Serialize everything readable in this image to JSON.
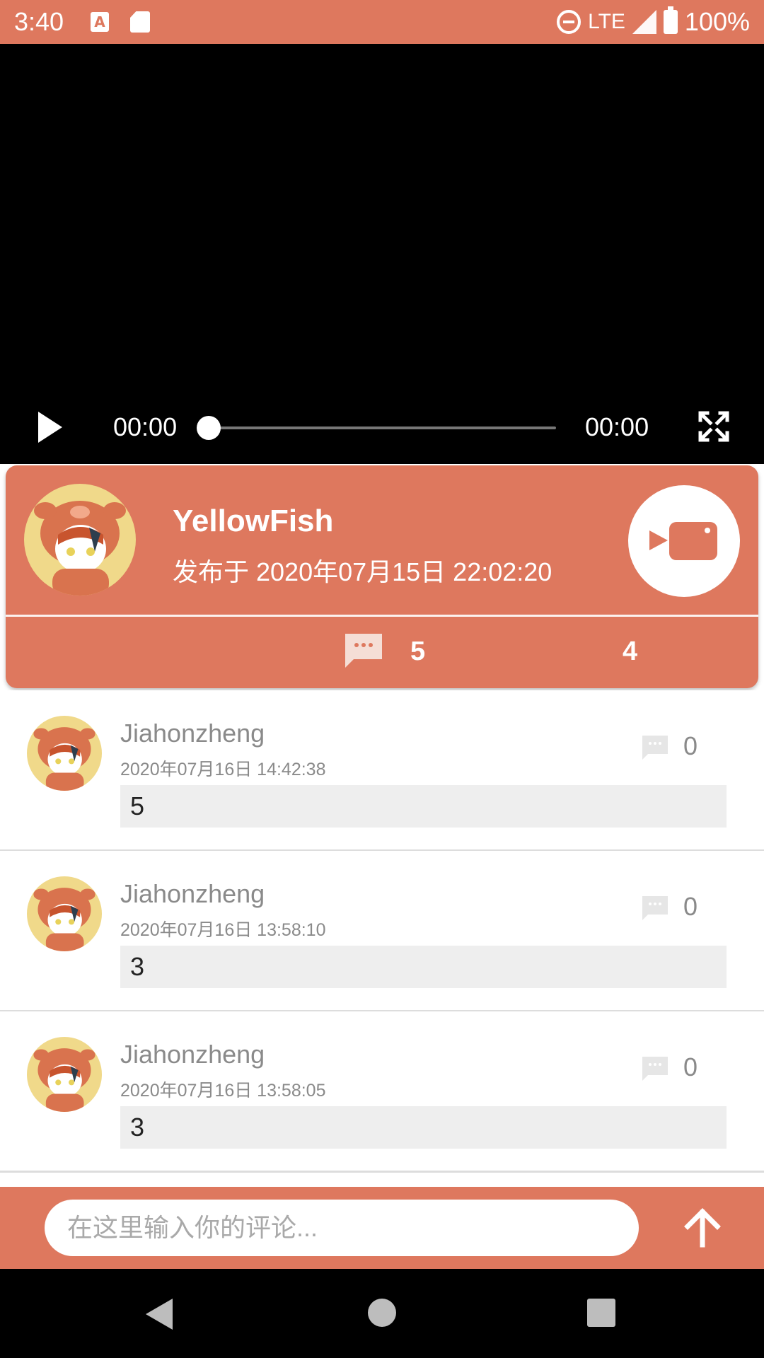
{
  "status_bar": {
    "time": "3:40",
    "network": "LTE",
    "battery": "100%"
  },
  "video": {
    "current_time": "00:00",
    "total_time": "00:00",
    "progress": 0
  },
  "post": {
    "author": "YellowFish",
    "published": "发布于 2020年07月15日 22:02:20",
    "comment_count": "5",
    "other_count": "4"
  },
  "comments": [
    {
      "name": "Jiahonzheng",
      "date": "2020年07月16日 14:42:38",
      "reply_count": "0",
      "body": "5"
    },
    {
      "name": "Jiahonzheng",
      "date": "2020年07月16日 13:58:10",
      "reply_count": "0",
      "body": "3"
    },
    {
      "name": "Jiahonzheng",
      "date": "2020年07月16日 13:58:05",
      "reply_count": "0",
      "body": "3"
    }
  ],
  "input": {
    "placeholder": "在这里输入你的评论..."
  },
  "icons": {
    "play": "play-icon",
    "fullscreen": "fullscreen-icon",
    "video_badge": "video-camera-icon",
    "comment": "comment-bubble-icon",
    "send": "arrow-up-icon",
    "nav_back": "back-triangle-icon",
    "nav_home": "home-circle-icon",
    "nav_recents": "recents-square-icon"
  },
  "colors": {
    "accent": "#DE785E",
    "video_bg": "#000000",
    "comment_box": "#EEEEEE",
    "muted_text": "#8A8A8A"
  }
}
